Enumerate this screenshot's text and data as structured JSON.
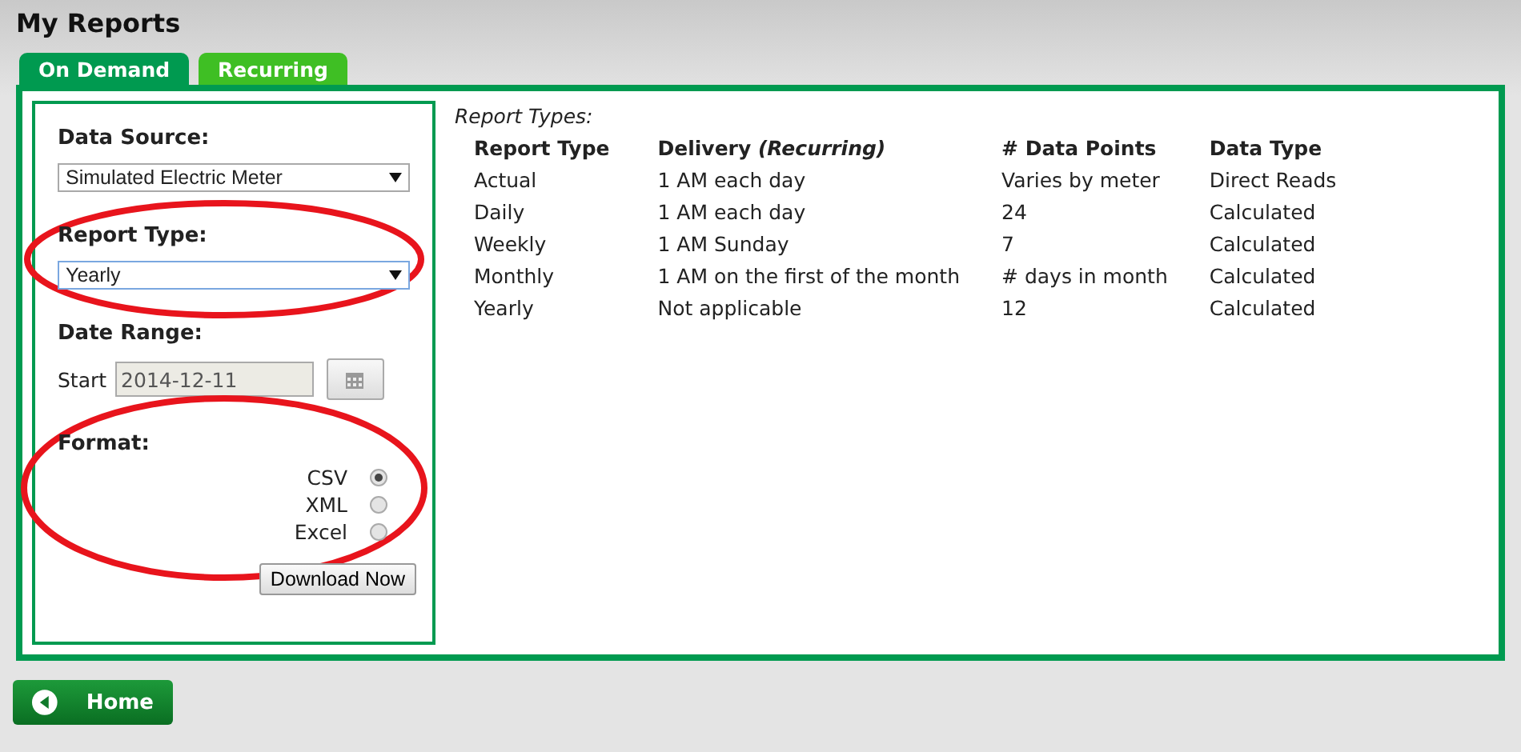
{
  "page_title": "My Reports",
  "tabs": [
    {
      "label": "On Demand",
      "selected": true
    },
    {
      "label": "Recurring",
      "selected": false
    }
  ],
  "form": {
    "data_source": {
      "label": "Data Source:",
      "value": "Simulated Electric Meter"
    },
    "report_type": {
      "label": "Report Type:",
      "value": "Yearly",
      "highlighted": true
    },
    "date_range": {
      "label": "Date Range:",
      "start_label": "Start",
      "start_value": "2014-12-11"
    },
    "format": {
      "label": "Format:",
      "highlighted": true,
      "options": [
        {
          "label": "CSV",
          "selected": true
        },
        {
          "label": "XML",
          "selected": false
        },
        {
          "label": "Excel",
          "selected": false
        }
      ]
    },
    "download_button": "Download Now"
  },
  "report_types": {
    "caption": "Report Types:",
    "columns": [
      "Report Type",
      "Delivery *(Recurring)*",
      "# Data Points",
      "Data Type"
    ],
    "rows": [
      [
        "Actual",
        "1 AM each day",
        "Varies by meter",
        "Direct Reads"
      ],
      [
        "Daily",
        "1 AM each day",
        "24",
        "Calculated"
      ],
      [
        "Weekly",
        "1 AM Sunday",
        "7",
        "Calculated"
      ],
      [
        "Monthly",
        "1 AM on the first of the month",
        "# days in month",
        "Calculated"
      ],
      [
        "Yearly",
        "Not applicable",
        "12",
        "Calculated"
      ]
    ]
  },
  "home_button": "Home"
}
